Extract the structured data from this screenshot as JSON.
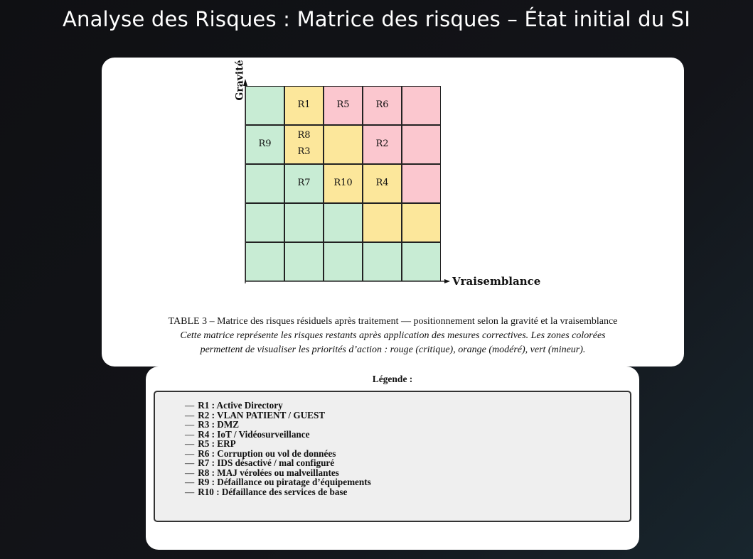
{
  "slide": {
    "title": "Analyse des Risques : Matrice des risques – État initial du SI"
  },
  "matrix": {
    "y_axis_label": "Gravité",
    "x_axis_label": "Vraisemblance",
    "colors": {
      "green": "#c8ecd4",
      "yellow": "#fce79b",
      "red": "#fbc7cf"
    },
    "rows": [
      {
        "cells": [
          {
            "color": "green",
            "risks": []
          },
          {
            "color": "yellow",
            "risks": [
              "R1"
            ]
          },
          {
            "color": "red",
            "risks": [
              "R5"
            ]
          },
          {
            "color": "red",
            "risks": [
              "R6"
            ]
          },
          {
            "color": "red",
            "risks": []
          }
        ]
      },
      {
        "cells": [
          {
            "color": "green",
            "risks": [
              "R9"
            ]
          },
          {
            "color": "yellow",
            "risks": [
              "R8",
              "R3"
            ]
          },
          {
            "color": "yellow",
            "risks": []
          },
          {
            "color": "red",
            "risks": [
              "R2"
            ]
          },
          {
            "color": "red",
            "risks": []
          }
        ]
      },
      {
        "cells": [
          {
            "color": "green",
            "risks": []
          },
          {
            "color": "green",
            "risks": [
              "R7"
            ]
          },
          {
            "color": "yellow",
            "risks": [
              "R10"
            ]
          },
          {
            "color": "yellow",
            "risks": [
              "R4"
            ]
          },
          {
            "color": "red",
            "risks": []
          }
        ]
      },
      {
        "cells": [
          {
            "color": "green",
            "risks": []
          },
          {
            "color": "green",
            "risks": []
          },
          {
            "color": "green",
            "risks": []
          },
          {
            "color": "yellow",
            "risks": []
          },
          {
            "color": "yellow",
            "risks": []
          }
        ]
      },
      {
        "cells": [
          {
            "color": "green",
            "risks": []
          },
          {
            "color": "green",
            "risks": []
          },
          {
            "color": "green",
            "risks": []
          },
          {
            "color": "green",
            "risks": []
          },
          {
            "color": "green",
            "risks": []
          }
        ]
      }
    ],
    "caption_line1": "TABLE 3 – Matrice des risques résiduels après traitement — positionnement selon la gravité et la vraisemblance",
    "caption_line2": "Cette matrice représente les risques restants après application des mesures correctives. Les zones colorées",
    "caption_line3": "permettent de visualiser les priorités d’action : rouge (critique), orange (modéré), vert (mineur)."
  },
  "legend": {
    "title": "Légende :",
    "items": [
      "R1 : Active Directory",
      "R2 : VLAN PATIENT / GUEST",
      "R3 : DMZ",
      "R4 : IoT / Vidéosurveillance",
      "R5 : ERP",
      "R6 : Corruption ou vol de données",
      "R7 : IDS désactivé / mal configuré",
      "R8 : MAJ vérolées ou malveillantes",
      "R9 : Défaillance ou piratage d’équipements",
      "R10 : Défaillance des services de base"
    ]
  }
}
